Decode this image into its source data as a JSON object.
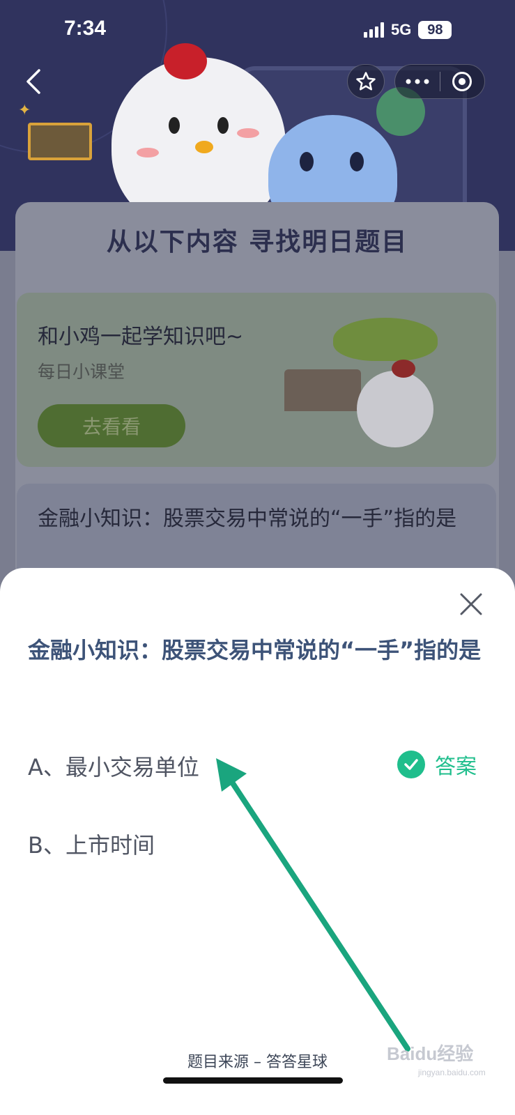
{
  "status_bar": {
    "time": "7:34",
    "network": "5G",
    "battery": "98"
  },
  "nav": {
    "back_icon": "chevron-left-icon",
    "favorite_icon": "star-icon",
    "more_icon": "more-dots-icon",
    "close_miniapp_icon": "target-icon"
  },
  "background": {
    "section_title": "从以下内容 寻找明日题目",
    "lesson": {
      "title": "和小鸡一起学知识吧~",
      "subtitle": "每日小课堂",
      "button": "去看看"
    },
    "quiz_preview": "金融小知识：股票交易中常说的“一手”指的是"
  },
  "sheet": {
    "question": "金融小知识：股票交易中常说的“一手”指的是",
    "options": [
      {
        "label": "A、最小交易单位",
        "correct": true
      },
      {
        "label": "B、上市时间",
        "correct": false
      }
    ],
    "answer_label": "答案",
    "source": "题目来源 – 答答星球"
  },
  "watermark": {
    "brand": "Baidu经验",
    "domain": "jingyan.baidu.com"
  },
  "colors": {
    "accent_green": "#1fbe8c",
    "question_blue": "#3d5378",
    "header_bg": "#30335e"
  }
}
